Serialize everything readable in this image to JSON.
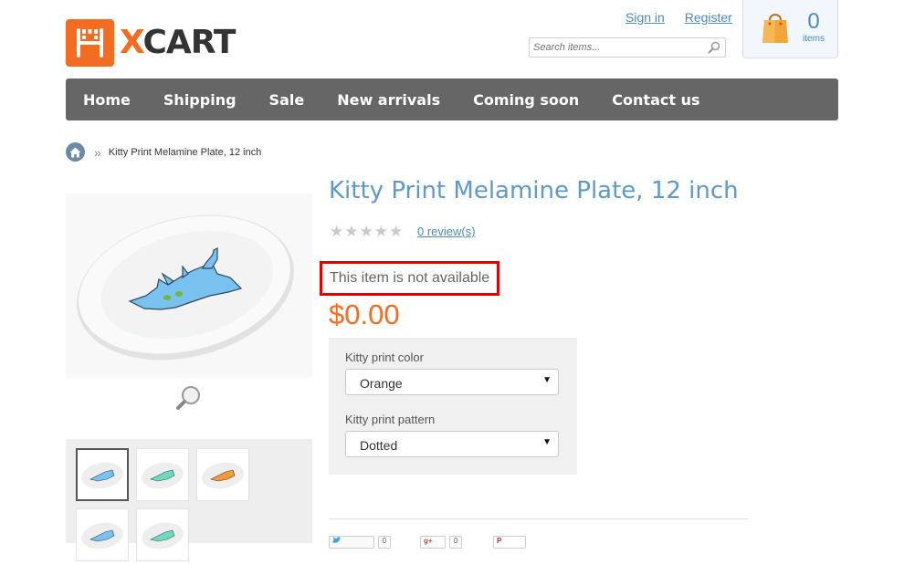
{
  "header": {
    "logo_text_x": "X",
    "logo_text_cart": "CART",
    "sign_in": "Sign in",
    "register": "Register",
    "search_placeholder": "Search items...",
    "cart_count": "0",
    "cart_items_label": "items"
  },
  "nav": {
    "items": [
      "Home",
      "Shipping",
      "Sale",
      "New arrivals",
      "Coming soon",
      "Contact us"
    ]
  },
  "breadcrumb": {
    "current": "Kitty Print Melamine Plate, 12 inch"
  },
  "product": {
    "title": "Kitty Print Melamine Plate, 12 inch",
    "reviews": "0 review(s)",
    "rating": 0,
    "availability": "This item is not available",
    "price": "$0.00",
    "options": [
      {
        "label": "Kitty print color",
        "value": "Orange"
      },
      {
        "label": "Kitty print pattern",
        "value": "Dotted"
      }
    ]
  },
  "social": {
    "tweet_count": "0",
    "gplus_count": "0"
  },
  "colors": {
    "brand_orange": "#f26d22",
    "link_blue": "#4a8ac0",
    "title_blue": "#5d9acb",
    "nav_gray": "#666666",
    "highlight_red": "#e20000"
  }
}
